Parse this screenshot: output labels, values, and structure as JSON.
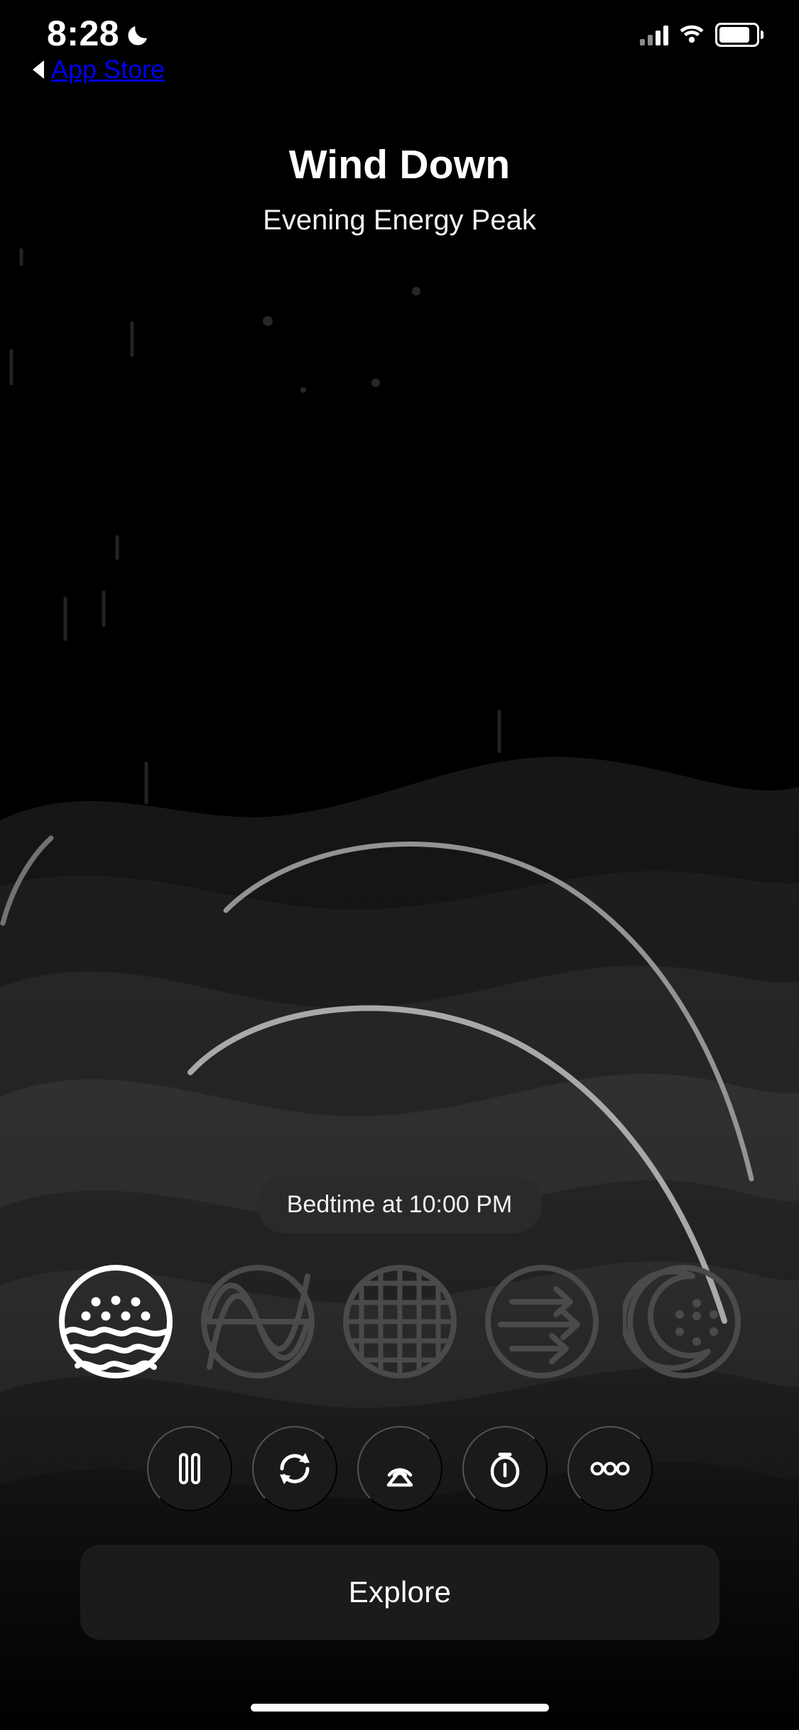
{
  "status_bar": {
    "time": "8:28",
    "dnd_icon": "moon-icon",
    "signal_icon": "cellular-signal-icon",
    "wifi_icon": "wifi-icon",
    "battery_icon": "battery-icon"
  },
  "back_link": {
    "label": "App Store",
    "icon": "back-caret-icon"
  },
  "header": {
    "title": "Wind Down",
    "subtitle": "Evening Energy Peak"
  },
  "bedtime": {
    "label": "Bedtime at 10:00 PM"
  },
  "sound_modes": {
    "active_index": 0,
    "items": [
      {
        "id": "rain-waves",
        "icon": "rain-waves-icon",
        "active": true
      },
      {
        "id": "sine-wave",
        "icon": "sine-wave-icon",
        "active": false
      },
      {
        "id": "grid-mesh",
        "icon": "grid-mesh-icon",
        "active": false
      },
      {
        "id": "wind-arrows",
        "icon": "wind-arrows-icon",
        "active": false
      },
      {
        "id": "moon-stars",
        "icon": "moon-stars-icon",
        "active": false
      }
    ]
  },
  "controls": {
    "items": [
      {
        "id": "pause",
        "icon": "pause-icon"
      },
      {
        "id": "loop",
        "icon": "loop-icon"
      },
      {
        "id": "airplay",
        "icon": "airplay-icon"
      },
      {
        "id": "timer",
        "icon": "timer-icon"
      },
      {
        "id": "more",
        "icon": "more-icon"
      }
    ]
  },
  "explore": {
    "label": "Explore"
  },
  "colors": {
    "background": "#000000",
    "active_icon": "#ffffff",
    "inactive_icon": "#4a4a4a",
    "pill_bg": "#2a2a2a",
    "control_bg": "#1a1a1a",
    "explore_bg": "#1b1b1d"
  }
}
